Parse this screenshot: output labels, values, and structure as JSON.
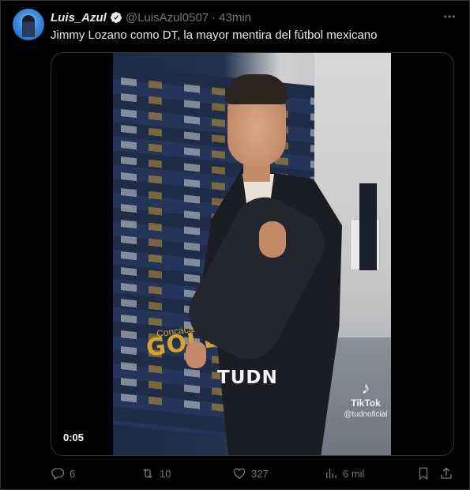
{
  "tweet": {
    "display_name": "Luis_Azul",
    "handle": "@LuisAzul0507",
    "separator": "·",
    "time": "43min",
    "text": "Jimmy Lozano como DT, la mayor mentira del fútbol mexicano"
  },
  "video": {
    "duration": "0:05",
    "watermark": "TUDN",
    "backdrop_text": "GOLD",
    "backdrop_subtext": "Concacaf",
    "tiktok_label": "TikTok",
    "tiktok_handle": "@tudnoficial",
    "tiktok_glyph": "♪"
  },
  "actions": {
    "replies": "6",
    "retweets": "10",
    "likes": "327",
    "views": "6 mil"
  },
  "icons": {
    "verified": "verified-badge-icon",
    "more": "more-options-icon",
    "reply": "reply-icon",
    "retweet": "retweet-icon",
    "like": "heart-icon",
    "views": "views-chart-icon",
    "bookmark": "bookmark-icon",
    "share": "share-icon"
  },
  "colors": {
    "background": "#000000",
    "text": "#e7e9ea",
    "muted": "#71767b",
    "border": "#2f3336"
  }
}
